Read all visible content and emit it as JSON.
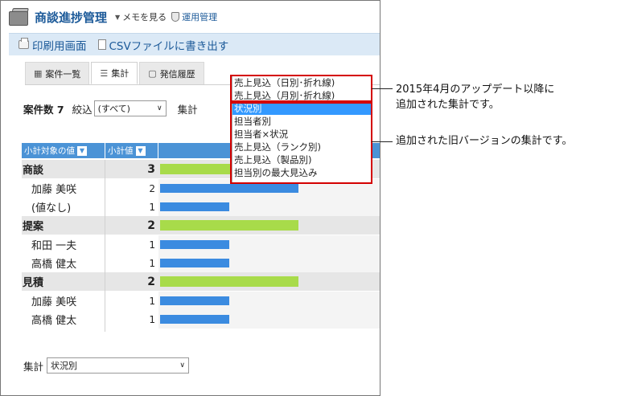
{
  "app": {
    "title": "商談進捗管理",
    "memo_link": "メモを見る",
    "admin_link": "運用管理"
  },
  "toolbar": {
    "print_label": "印刷用画面",
    "csv_label": "CSVファイルに書き出す"
  },
  "tabs": [
    {
      "label": "案件一覧",
      "icon": "table-icon"
    },
    {
      "label": "集計",
      "icon": "chart-icon",
      "active": true
    },
    {
      "label": "発信履歴",
      "icon": "history-icon"
    }
  ],
  "filters": {
    "count_label": "案件数 7",
    "narrow_label": "絞込",
    "narrow_value": "(すべて)",
    "aggregate_label": "集計"
  },
  "table": {
    "col_subtotal_target": "小計対象の値",
    "col_subtotal_value": "小計値",
    "groups": [
      {
        "name": "商談",
        "value": 3,
        "rows": [
          {
            "name": "加藤 美咲",
            "value": 2
          },
          {
            "name": "(値なし)",
            "value": 1
          }
        ]
      },
      {
        "name": "提案",
        "value": 2,
        "rows": [
          {
            "name": "和田 一夫",
            "value": 1
          },
          {
            "name": "高橋 健太",
            "value": 1
          }
        ]
      },
      {
        "name": "見積",
        "value": 2,
        "rows": [
          {
            "name": "加藤 美咲",
            "value": 1
          },
          {
            "name": "高橋 健太",
            "value": 1
          }
        ]
      }
    ]
  },
  "dropdown": {
    "options": [
      "売上見込（日別･折れ線)",
      "売上見込（月別･折れ線)",
      "状況別",
      "担当者別",
      "担当者×状況",
      "売上見込（ランク別)",
      "売上見込（製品別)",
      "担当別の最大見込み"
    ],
    "selected": "状況別"
  },
  "bottom": {
    "aggregate_label": "集計",
    "aggregate_value": "状況別"
  },
  "callouts": {
    "new": "2015年4月のアップデート以降に\n追加された集計です。",
    "old": "追加された旧バージョンの集計です。"
  },
  "colors": {
    "header_blue": "#4b93d6",
    "group_bar": "#a8db4a",
    "sub_bar": "#3b8be0",
    "highlight": "#d40000"
  }
}
